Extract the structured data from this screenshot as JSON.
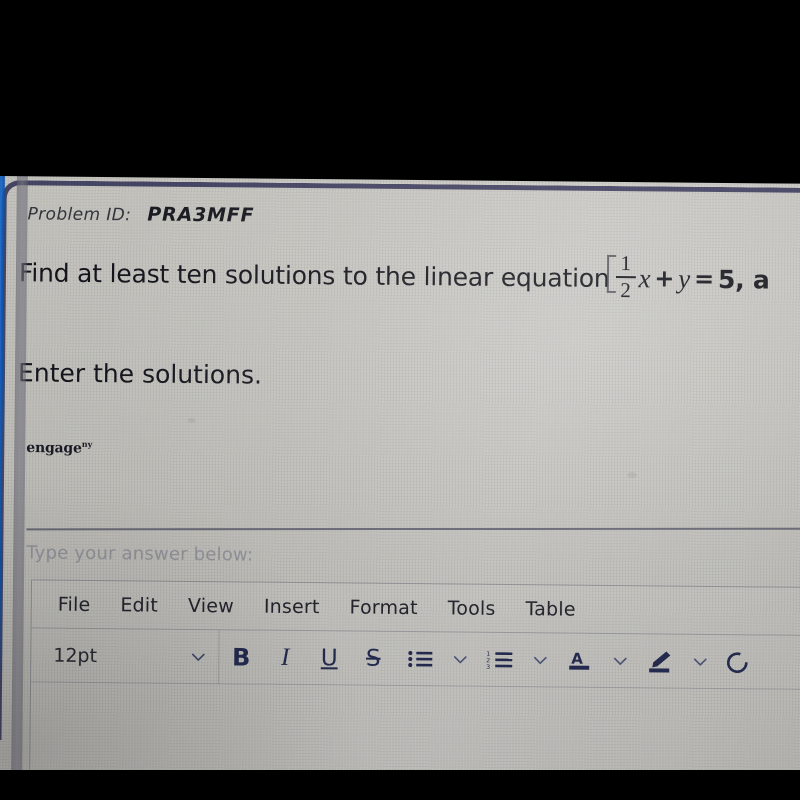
{
  "problem": {
    "id_label": "Problem ID:",
    "id_value": "PRA3MFF",
    "question_prefix": "Find at least ten solutions to the linear equation",
    "equation": {
      "fraction_numerator": "1",
      "fraction_denominator": "2",
      "variable_x": "x",
      "plus": "+",
      "variable_y": "y",
      "equals": "=",
      "value": "5",
      "trailing": ", a"
    },
    "instruction": "Enter the solutions.",
    "logo_main": "engage",
    "logo_sup": "ny"
  },
  "answer_area": {
    "prompt": "Type your answer below:"
  },
  "editor": {
    "menu": [
      {
        "label": "File"
      },
      {
        "label": "Edit"
      },
      {
        "label": "View"
      },
      {
        "label": "Insert"
      },
      {
        "label": "Format"
      },
      {
        "label": "Tools"
      },
      {
        "label": "Table"
      }
    ],
    "font_size": "12pt",
    "toolbar": [
      {
        "name": "bold",
        "glyph": "B"
      },
      {
        "name": "italic",
        "glyph": "I"
      },
      {
        "name": "underline",
        "glyph": "U"
      },
      {
        "name": "strikethrough",
        "glyph": "S"
      },
      {
        "name": "bullet-list",
        "glyph": ""
      },
      {
        "name": "numbered-list",
        "glyph": ""
      },
      {
        "name": "text-color",
        "glyph": "A"
      },
      {
        "name": "highlight-color",
        "glyph": ""
      }
    ]
  },
  "colors": {
    "screen_bg": "#bcbbb6",
    "card_border": "#3a3a5c",
    "toolbar_icon": "#232a4e",
    "text_primary": "#14141c",
    "text_muted": "#8e8e96",
    "edge_blue": "#1565c8",
    "photo_band": "#000000"
  }
}
